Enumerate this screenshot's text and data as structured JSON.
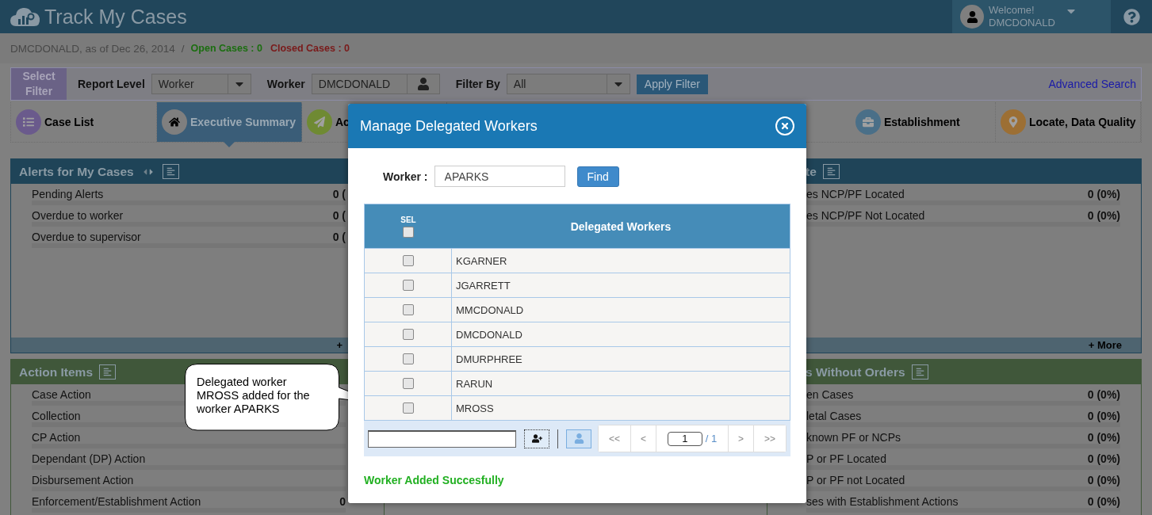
{
  "app": {
    "title": "Track My Cases",
    "welcome": "Welcome!",
    "user": "DMCDONALD"
  },
  "context": {
    "summary": "DMCDONALD, as of Dec 26, 2014",
    "separator": "/",
    "open_cases": "Open Cases : 0",
    "closed_cases": "Closed Cases : 0"
  },
  "filter": {
    "badge": "Select Filter",
    "report_level_label": "Report Level",
    "report_level": "Worker",
    "worker_label": "Worker",
    "worker": "DMCDONALD",
    "filter_by_label": "Filter By",
    "filter_by": "All",
    "apply": "Apply Filter",
    "advanced": "Advanced Search"
  },
  "nav_tabs_left": [
    {
      "label": "Case List",
      "selected": false,
      "kind": "list",
      "color": "#6a5a8c"
    },
    {
      "label": "Executive Summary",
      "selected": true,
      "kind": "home",
      "color": "#7f7f7f"
    },
    {
      "label": "Ac",
      "selected": false,
      "kind": "send",
      "color": "#6f8a33"
    }
  ],
  "nav_tabs_right": [
    {
      "label": "Establishment",
      "selected": false,
      "kind": "briefcase",
      "color": "#4a6f88"
    },
    {
      "label": "Locate, Data Quality",
      "selected": false,
      "kind": "pin",
      "color": "#9c6f34"
    }
  ],
  "left_panels": [
    {
      "title": "Alerts for My Cases",
      "kind": "blue",
      "arrows": true,
      "more": "+",
      "rows": [
        {
          "label": "Pending Alerts",
          "value": "0 ("
        },
        {
          "label": "Overdue to worker",
          "value": "0 ("
        },
        {
          "label": "Overdue to supervisor",
          "value": "0 ("
        }
      ]
    },
    {
      "title": "Action Items",
      "kind": "green",
      "rows": [
        {
          "label": "Case Action"
        },
        {
          "label": "Collection"
        },
        {
          "label": "CP Action"
        },
        {
          "label": "Dependant (DP) Action"
        },
        {
          "label": "Disbursement Action"
        },
        {
          "label": "Enforcement/Establishment Action",
          "value": "0"
        }
      ]
    }
  ],
  "right_panels": [
    {
      "title": "te",
      "kind": "blue",
      "more": "+ More",
      "rows": [
        {
          "label": "es NCP/PF Located",
          "value": "0 (0%)"
        },
        {
          "label": "es NCP/PF Not Located",
          "value": "0 (0%)"
        }
      ]
    },
    {
      "title": "s Without Orders",
      "kind": "green",
      "rows": [
        {
          "label": "en Cases",
          "value": "0 (0%)"
        },
        {
          "label": "letal Cases",
          "value": "0 (0%)"
        },
        {
          "label": "known PF or NCPs",
          "value": "0 (0%)"
        },
        {
          "label": "P or PF Located",
          "value": "0 (0%)"
        },
        {
          "label": "P or PF not Located",
          "value": "0 (0%)"
        },
        {
          "label": "ses with Establishment Actions",
          "value": "0 (0%)"
        }
      ]
    }
  ],
  "modal": {
    "title": "Manage Delegated Workers",
    "worker_label": "Worker :",
    "worker": "APARKS",
    "find": "Find",
    "sel_header": "SEL",
    "sel_all_checked": false,
    "column": "Delegated Workers",
    "rows": [
      {
        "name": "KGARNER",
        "checked": false
      },
      {
        "name": "JGARRETT",
        "checked": false
      },
      {
        "name": "MMCDONALD",
        "checked": false
      },
      {
        "name": "DMCDONALD",
        "checked": false
      },
      {
        "name": "DMURPHREE",
        "checked": false
      },
      {
        "name": "RARUN",
        "checked": false
      },
      {
        "name": "MROSS",
        "checked": false
      }
    ],
    "pager": {
      "first": "<<",
      "prev": "<",
      "page": "1",
      "total": "/ 1",
      "next": ">",
      "last": ">>"
    },
    "message": "Worker Added Succesfully"
  },
  "callout": {
    "text": "Delegated worker MROSS added for the worker APARKS"
  }
}
